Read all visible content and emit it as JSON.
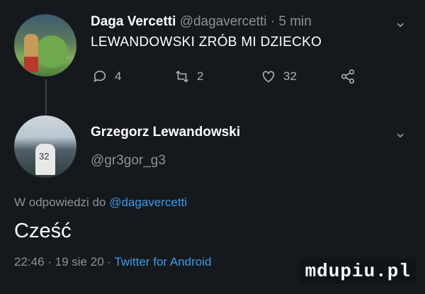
{
  "tweet": {
    "display_name": "Daga Vercetti",
    "handle": "@dagavercetti",
    "time": "5 min",
    "separator": "·",
    "text": "LEWANDOWSKI ZRÓB MI DZIECKO",
    "replies": "4",
    "retweets": "2",
    "likes": "32"
  },
  "reply": {
    "display_name": "Grzegorz Lewandowski",
    "handle": "@gr3gor_g3",
    "in_reply_prefix": "W odpowiedzi do",
    "in_reply_handle": "@dagavercetti",
    "text": "Cześć",
    "meta_time": "22:46 · 19 sie 20 ·",
    "client": "Twitter for Android"
  },
  "watermark": "mdupiu.pl",
  "colors": {
    "background": "#15191d",
    "link": "#3b9ae8",
    "muted": "#8b9198"
  },
  "icons": [
    "reply-icon",
    "retweet-icon",
    "like-icon",
    "share-icon",
    "chevron-down-icon"
  ]
}
